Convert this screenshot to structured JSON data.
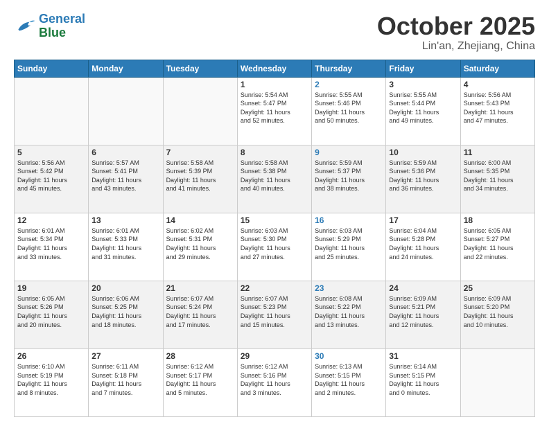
{
  "header": {
    "logo_line1": "General",
    "logo_line2": "Blue",
    "month": "October 2025",
    "location": "Lin'an, Zhejiang, China"
  },
  "weekdays": [
    "Sunday",
    "Monday",
    "Tuesday",
    "Wednesday",
    "Thursday",
    "Friday",
    "Saturday"
  ],
  "weeks": [
    [
      {
        "day": "",
        "info": ""
      },
      {
        "day": "",
        "info": ""
      },
      {
        "day": "",
        "info": ""
      },
      {
        "day": "1",
        "info": "Sunrise: 5:54 AM\nSunset: 5:47 PM\nDaylight: 11 hours\nand 52 minutes."
      },
      {
        "day": "2",
        "info": "Sunrise: 5:55 AM\nSunset: 5:46 PM\nDaylight: 11 hours\nand 50 minutes.",
        "thursday": true
      },
      {
        "day": "3",
        "info": "Sunrise: 5:55 AM\nSunset: 5:44 PM\nDaylight: 11 hours\nand 49 minutes."
      },
      {
        "day": "4",
        "info": "Sunrise: 5:56 AM\nSunset: 5:43 PM\nDaylight: 11 hours\nand 47 minutes."
      }
    ],
    [
      {
        "day": "5",
        "info": "Sunrise: 5:56 AM\nSunset: 5:42 PM\nDaylight: 11 hours\nand 45 minutes."
      },
      {
        "day": "6",
        "info": "Sunrise: 5:57 AM\nSunset: 5:41 PM\nDaylight: 11 hours\nand 43 minutes."
      },
      {
        "day": "7",
        "info": "Sunrise: 5:58 AM\nSunset: 5:39 PM\nDaylight: 11 hours\nand 41 minutes."
      },
      {
        "day": "8",
        "info": "Sunrise: 5:58 AM\nSunset: 5:38 PM\nDaylight: 11 hours\nand 40 minutes."
      },
      {
        "day": "9",
        "info": "Sunrise: 5:59 AM\nSunset: 5:37 PM\nDaylight: 11 hours\nand 38 minutes.",
        "thursday": true
      },
      {
        "day": "10",
        "info": "Sunrise: 5:59 AM\nSunset: 5:36 PM\nDaylight: 11 hours\nand 36 minutes."
      },
      {
        "day": "11",
        "info": "Sunrise: 6:00 AM\nSunset: 5:35 PM\nDaylight: 11 hours\nand 34 minutes."
      }
    ],
    [
      {
        "day": "12",
        "info": "Sunrise: 6:01 AM\nSunset: 5:34 PM\nDaylight: 11 hours\nand 33 minutes."
      },
      {
        "day": "13",
        "info": "Sunrise: 6:01 AM\nSunset: 5:33 PM\nDaylight: 11 hours\nand 31 minutes."
      },
      {
        "day": "14",
        "info": "Sunrise: 6:02 AM\nSunset: 5:31 PM\nDaylight: 11 hours\nand 29 minutes."
      },
      {
        "day": "15",
        "info": "Sunrise: 6:03 AM\nSunset: 5:30 PM\nDaylight: 11 hours\nand 27 minutes."
      },
      {
        "day": "16",
        "info": "Sunrise: 6:03 AM\nSunset: 5:29 PM\nDaylight: 11 hours\nand 25 minutes.",
        "thursday": true
      },
      {
        "day": "17",
        "info": "Sunrise: 6:04 AM\nSunset: 5:28 PM\nDaylight: 11 hours\nand 24 minutes."
      },
      {
        "day": "18",
        "info": "Sunrise: 6:05 AM\nSunset: 5:27 PM\nDaylight: 11 hours\nand 22 minutes."
      }
    ],
    [
      {
        "day": "19",
        "info": "Sunrise: 6:05 AM\nSunset: 5:26 PM\nDaylight: 11 hours\nand 20 minutes."
      },
      {
        "day": "20",
        "info": "Sunrise: 6:06 AM\nSunset: 5:25 PM\nDaylight: 11 hours\nand 18 minutes."
      },
      {
        "day": "21",
        "info": "Sunrise: 6:07 AM\nSunset: 5:24 PM\nDaylight: 11 hours\nand 17 minutes."
      },
      {
        "day": "22",
        "info": "Sunrise: 6:07 AM\nSunset: 5:23 PM\nDaylight: 11 hours\nand 15 minutes."
      },
      {
        "day": "23",
        "info": "Sunrise: 6:08 AM\nSunset: 5:22 PM\nDaylight: 11 hours\nand 13 minutes.",
        "thursday": true
      },
      {
        "day": "24",
        "info": "Sunrise: 6:09 AM\nSunset: 5:21 PM\nDaylight: 11 hours\nand 12 minutes."
      },
      {
        "day": "25",
        "info": "Sunrise: 6:09 AM\nSunset: 5:20 PM\nDaylight: 11 hours\nand 10 minutes."
      }
    ],
    [
      {
        "day": "26",
        "info": "Sunrise: 6:10 AM\nSunset: 5:19 PM\nDaylight: 11 hours\nand 8 minutes."
      },
      {
        "day": "27",
        "info": "Sunrise: 6:11 AM\nSunset: 5:18 PM\nDaylight: 11 hours\nand 7 minutes."
      },
      {
        "day": "28",
        "info": "Sunrise: 6:12 AM\nSunset: 5:17 PM\nDaylight: 11 hours\nand 5 minutes."
      },
      {
        "day": "29",
        "info": "Sunrise: 6:12 AM\nSunset: 5:16 PM\nDaylight: 11 hours\nand 3 minutes."
      },
      {
        "day": "30",
        "info": "Sunrise: 6:13 AM\nSunset: 5:15 PM\nDaylight: 11 hours\nand 2 minutes.",
        "thursday": true
      },
      {
        "day": "31",
        "info": "Sunrise: 6:14 AM\nSunset: 5:15 PM\nDaylight: 11 hours\nand 0 minutes."
      },
      {
        "day": "",
        "info": ""
      }
    ]
  ]
}
